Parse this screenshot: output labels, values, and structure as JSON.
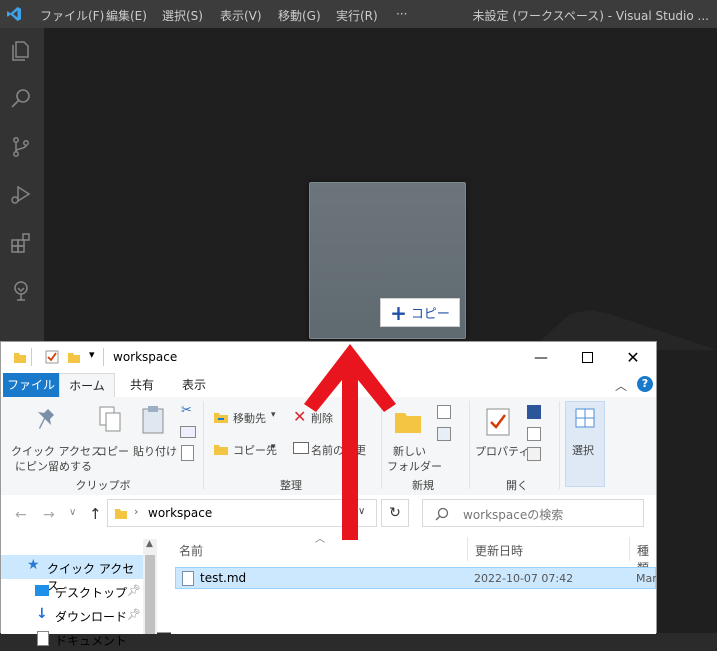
{
  "vscode": {
    "menu": [
      "ファイル(F)",
      "編集(E)",
      "選択(S)",
      "表示(V)",
      "移動(G)",
      "実行(R)",
      "···"
    ],
    "title": "未設定 (ワークスペース) - Visual Studio ...",
    "activity_icons": [
      "explorer-icon",
      "search-icon",
      "source-control-icon",
      "run-debug-icon",
      "extensions-icon",
      "remote-icon"
    ],
    "accent": "#007acc"
  },
  "drag": {
    "badge_text": "コピー",
    "badge_glyph": "+"
  },
  "explorer": {
    "title": "workspace",
    "tabs": [
      "ファイル",
      "ホーム",
      "共有",
      "表示"
    ],
    "ribbon": {
      "pin_label_1": "クイック アクセス",
      "pin_label_2": "にピン留めする",
      "copy": "コピー",
      "paste": "貼り付け",
      "clipboard_group": "クリップボード",
      "move_to": "移動先",
      "copy_to": "コピー先",
      "delete": "削除",
      "rename": "名前の変更",
      "organize_group": "整理",
      "new_folder_1": "新しい",
      "new_folder_2": "フォルダー",
      "new_group": "新規",
      "properties": "プロパティ",
      "open_group": "開く",
      "select": "選択"
    },
    "address": {
      "path": "workspace",
      "search_placeholder": "workspaceの検索"
    },
    "nav": {
      "items": [
        "クイック アクセス",
        "デスクトップ",
        "ダウンロード",
        "ドキュメント"
      ]
    },
    "columns": [
      "名前",
      "更新日時",
      "種類"
    ],
    "files": [
      {
        "name": "test.md",
        "modified": "2022-10-07 07:42",
        "type": "Mar"
      }
    ],
    "accent": "#1979ca"
  },
  "arrow_color": "#e8151e"
}
